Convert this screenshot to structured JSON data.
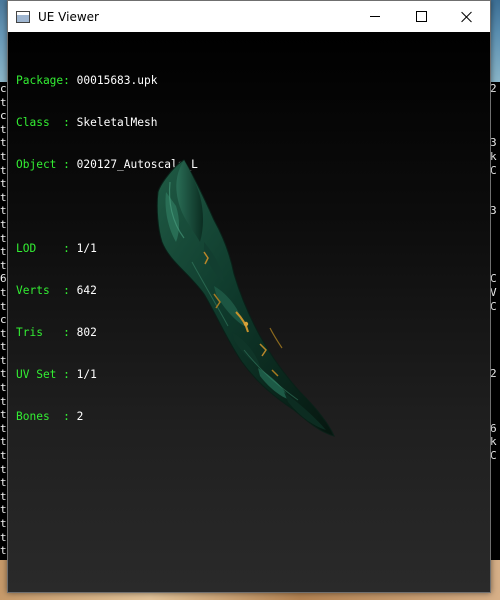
{
  "window": {
    "title": "UE Viewer"
  },
  "titlebar": {
    "controls": [
      "minimize-icon",
      "maximize-icon",
      "close-icon"
    ]
  },
  "info": {
    "package_label": "Package:",
    "package_value": "00015683.upk",
    "class_label": "Class  :",
    "class_value": "SkeletalMesh",
    "object_label": "Object :",
    "object_value": "020127_Autoscale_L",
    "lod_label": "LOD    :",
    "lod_value": "1/1",
    "verts_label": "Verts  :",
    "verts_value": "642",
    "tris_label": "Tris   :",
    "tris_value": "802",
    "uvset_label": "UV Set :",
    "uvset_value": "1/1",
    "bones_label": "Bones  :",
    "bones_value": "2"
  },
  "background_console": {
    "left_column": "c\nt\nc\nt\nt\nt\nt\nt\nt\nt\nt\nt\nt\nt\n6\nt\nt\nc\nt\nt\nt\nt\nt\nt\nt\nt\nt\nt\nt\nt\nt\nt\nt\nt\nt",
    "right_column": "2\n \n \n \n3\nk\nC\n \n \n3\n \n \n \n \nC\nV\nC\n \n \n \n \n2\n \n \n \n6\nk\nC\n \n \n "
  },
  "colors": {
    "label_green": "#33ee33",
    "value_white": "#ffffff",
    "viewport_top": "#000000",
    "viewport_bottom": "#2a2a2a"
  }
}
